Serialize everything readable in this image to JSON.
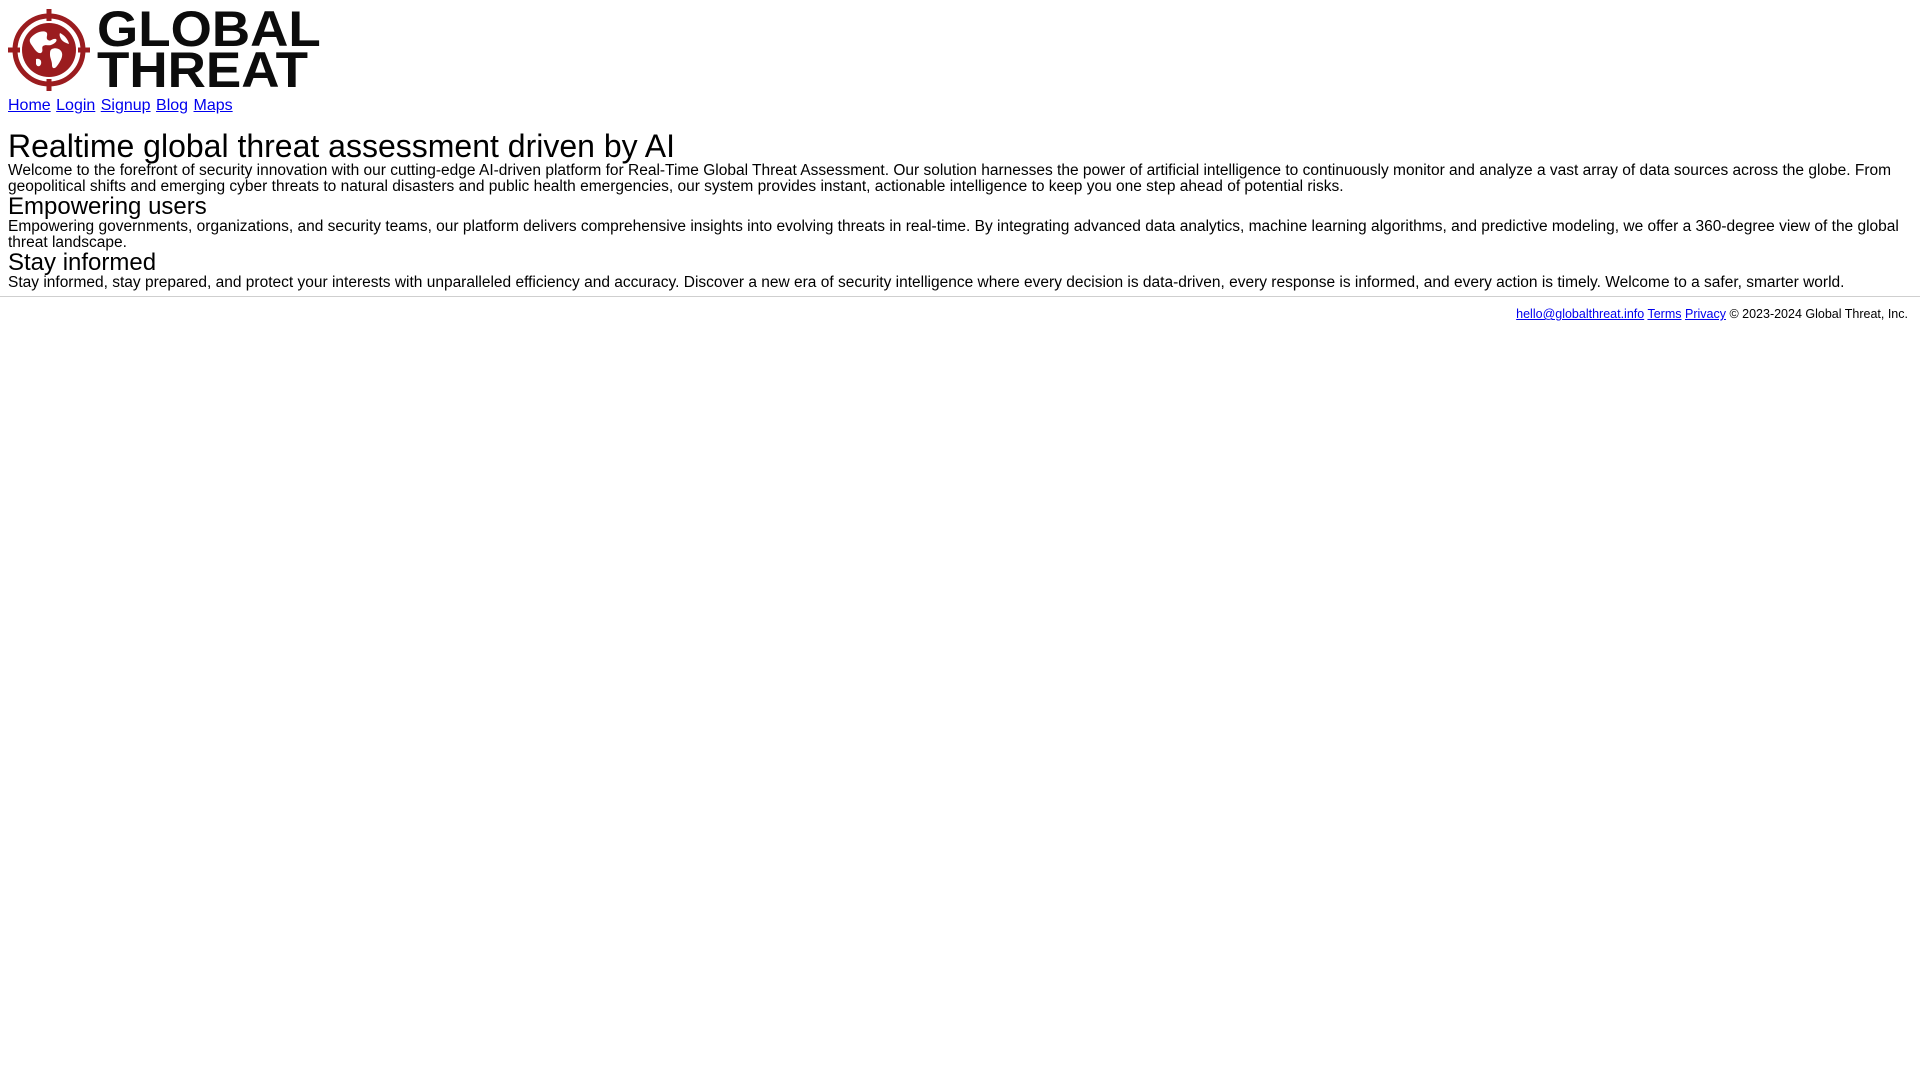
{
  "brand": {
    "logo_line1": "GLOBAL",
    "logo_line2": "THREAT",
    "logo_icon": "target-globe-icon",
    "accent_color": "#9b1c1f"
  },
  "nav": {
    "items": [
      {
        "label": "Home"
      },
      {
        "label": "Login"
      },
      {
        "label": "Signup"
      },
      {
        "label": "Blog"
      },
      {
        "label": "Maps"
      }
    ]
  },
  "main": {
    "title": "Realtime global threat assessment driven by AI",
    "intro": "Welcome to the forefront of security innovation with our cutting-edge AI-driven platform for Real-Time Global Threat Assessment. Our solution harnesses the power of artificial intelligence to continuously monitor and analyze a vast array of data sources across the globe. From geopolitical shifts and emerging cyber threats to natural disasters and public health emergencies, our system provides instant, actionable intelligence to keep you one step ahead of potential risks.",
    "sections": [
      {
        "heading": "Empowering users",
        "text": "Empowering governments, organizations, and security teams, our platform delivers comprehensive insights into evolving threats in real-time. By integrating advanced data analytics, machine learning algorithms, and predictive modeling, we offer a 360-degree view of the global threat landscape."
      },
      {
        "heading": "Stay informed",
        "text": "Stay informed, stay prepared, and protect your interests with unparalleled efficiency and accuracy. Discover a new era of security intelligence where every decision is data-driven, every response is informed, and every action is timely. Welcome to a safer, smarter world."
      }
    ]
  },
  "footer": {
    "email": "hello@globalthreat.info",
    "terms": "Terms",
    "privacy": "Privacy",
    "copyright": "© 2023-2024 Global Threat, Inc."
  }
}
